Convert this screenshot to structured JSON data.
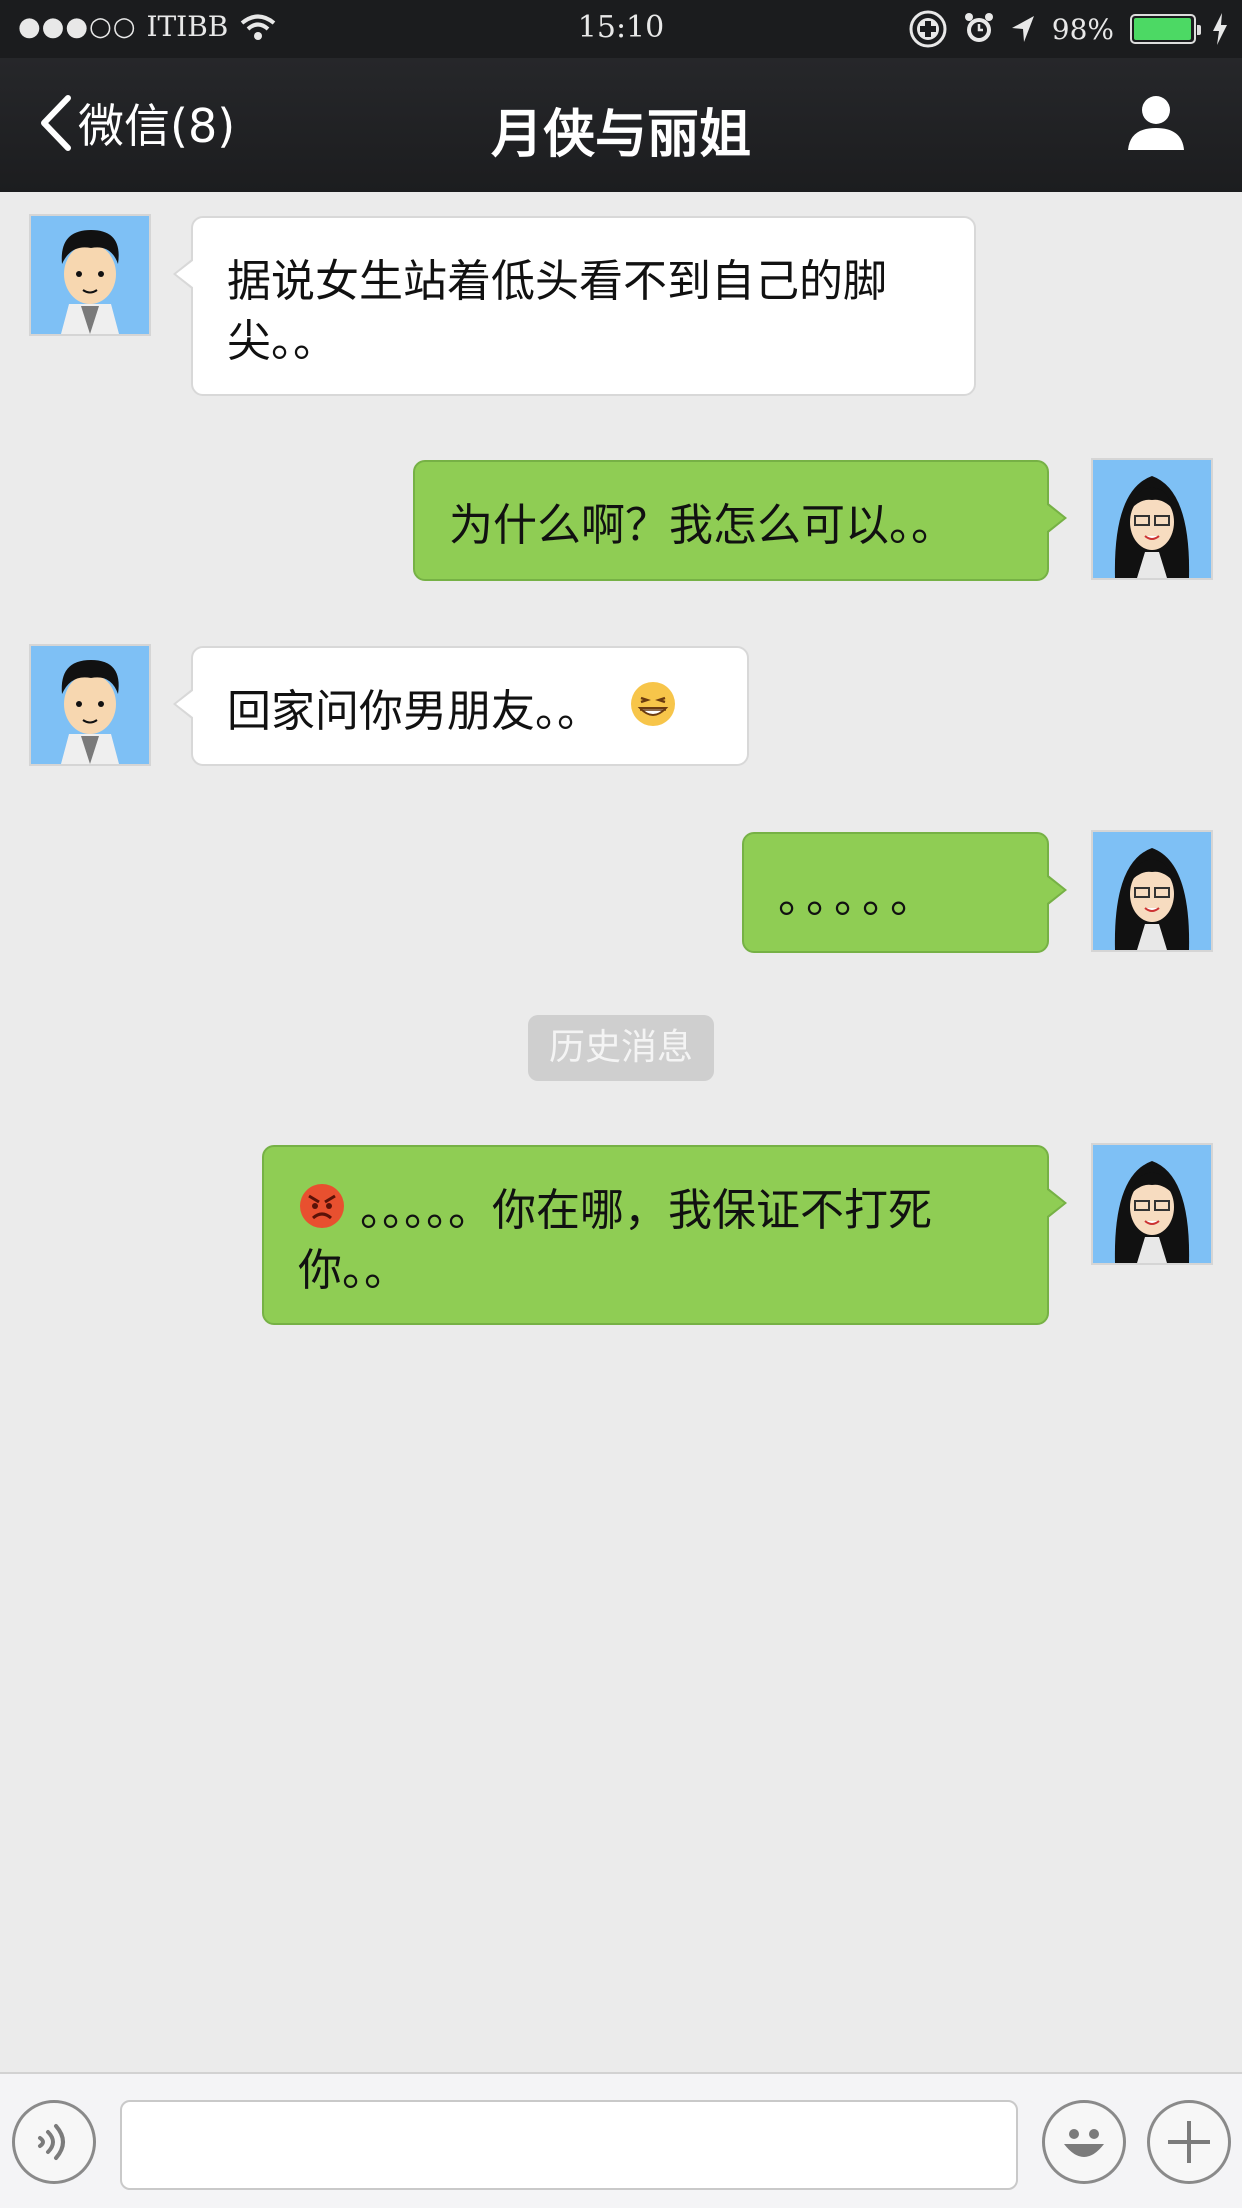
{
  "status_bar": {
    "signal": "●●●○○",
    "carrier": "ITIBB",
    "time": "15:10",
    "battery_percent": "98%",
    "battery_level": 0.98,
    "icons": [
      "wifi-icon",
      "rotation-lock-icon",
      "alarm-icon",
      "location-arrow-icon",
      "battery-icon",
      "charging-bolt-icon"
    ]
  },
  "nav": {
    "back_label": "微信(8)",
    "title": "月侠与丽姐",
    "profile_icon": "person-icon"
  },
  "messages": [
    {
      "side": "in",
      "text": "据说女生站着低头看不到自己的脚尖。。"
    },
    {
      "side": "out",
      "text": "为什么啊？我怎么可以。。"
    },
    {
      "side": "in",
      "text": "回家问你男朋友。。",
      "emoji": "grinning-squint-emoji"
    },
    {
      "side": "out",
      "text": "。。。。。"
    },
    {
      "side": "out",
      "text": "。。。。。你在哪，我保证不打死你。。",
      "emoji": "angry-face-emoji"
    }
  ],
  "divider_label": "历史消息",
  "input_bar": {
    "voice_icon": "voice-icon",
    "text_value": "",
    "emoji_icon": "smiley-icon",
    "more_icon": "plus-icon"
  },
  "colors": {
    "status_bg": "#1b1c1e",
    "nav_bg": "#26272a",
    "chat_bg": "#ebebeb",
    "incoming_bubble": "#ffffff",
    "outgoing_bubble": "#8fcd54",
    "avatar_bg": "#7ec0f5"
  }
}
